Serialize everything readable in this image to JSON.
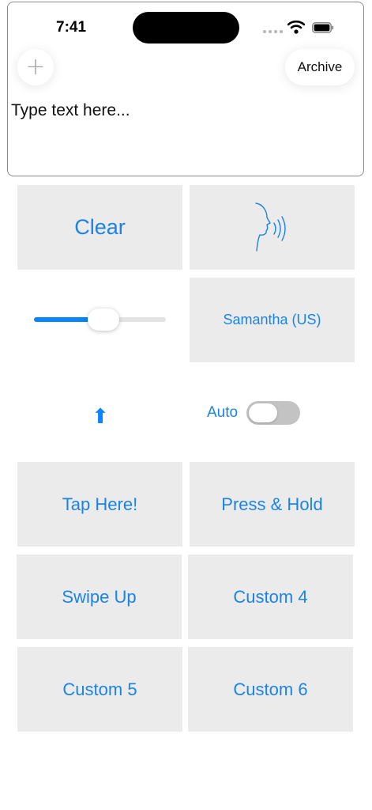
{
  "status_bar": {
    "time": "7:41",
    "icons": [
      "signal-dots-icon",
      "wifi-icon",
      "battery-icon"
    ]
  },
  "header": {
    "add_icon": "plus-icon",
    "add_symbol": "+",
    "archive_label": "Archive"
  },
  "editor": {
    "placeholder": "Type text here...",
    "value": ""
  },
  "controls": {
    "clear_label": "Clear",
    "speak_icon": "speaking-head-icon",
    "voice_label": "Samantha (US)",
    "rate_slider": {
      "value": 0.5
    },
    "up_arrow": "⬆",
    "auto_label": "Auto",
    "auto_enabled": false
  },
  "buttons": [
    {
      "label": "Tap Here!"
    },
    {
      "label": "Press & Hold"
    },
    {
      "label": "Swipe Up"
    },
    {
      "label": "Custom 4"
    },
    {
      "label": "Custom 5"
    },
    {
      "label": "Custom 6"
    }
  ],
  "colors": {
    "accent": "#1a84e6",
    "slider_fill": "#0a84ff",
    "tile_bg": "#ebebeb",
    "toggle_off": "#c3c3c3"
  }
}
